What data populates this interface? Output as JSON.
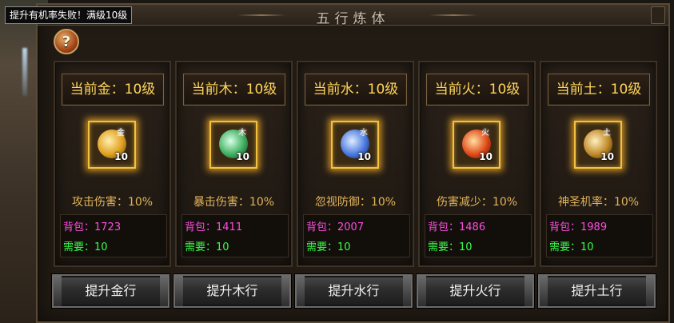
{
  "tooltip": "提升有机率失败！满级10级",
  "panel": {
    "title": "五行炼体"
  },
  "help": "?",
  "elements": [
    {
      "header": "当前金：10级",
      "effect": "攻击伤害：10%",
      "bag_label": "背包：",
      "bag": "1723",
      "need_label": "需要：",
      "need": "10",
      "level": "10",
      "glyph": "金",
      "button": "提升金行",
      "orb_color": "#e0a020"
    },
    {
      "header": "当前木：10级",
      "effect": "暴击伤害：10%",
      "bag_label": "背包：",
      "bag": "1411",
      "need_label": "需要：",
      "need": "10",
      "level": "10",
      "glyph": "木",
      "button": "提升木行",
      "orb_color": "#40b060"
    },
    {
      "header": "当前水：10级",
      "effect": "忽视防御：10%",
      "bag_label": "背包：",
      "bag": "2007",
      "need_label": "需要：",
      "need": "10",
      "level": "10",
      "glyph": "水",
      "button": "提升水行",
      "orb_color": "#4a7ae0"
    },
    {
      "header": "当前火：10级",
      "effect": "伤害减少：10%",
      "bag_label": "背包：",
      "bag": "1486",
      "need_label": "需要：",
      "need": "10",
      "level": "10",
      "glyph": "火",
      "button": "提升火行",
      "orb_color": "#e04a1a"
    },
    {
      "header": "当前土：10级",
      "effect": "神圣机率：10%",
      "bag_label": "背包：",
      "bag": "1989",
      "need_label": "需要：",
      "need": "10",
      "level": "10",
      "glyph": "土",
      "button": "提升土行",
      "orb_color": "#c08a2a"
    }
  ],
  "colors": {
    "header": "#ffd65a",
    "effect": "#e2b45a",
    "bag": "#ff4de0",
    "need": "#39ff4a"
  }
}
